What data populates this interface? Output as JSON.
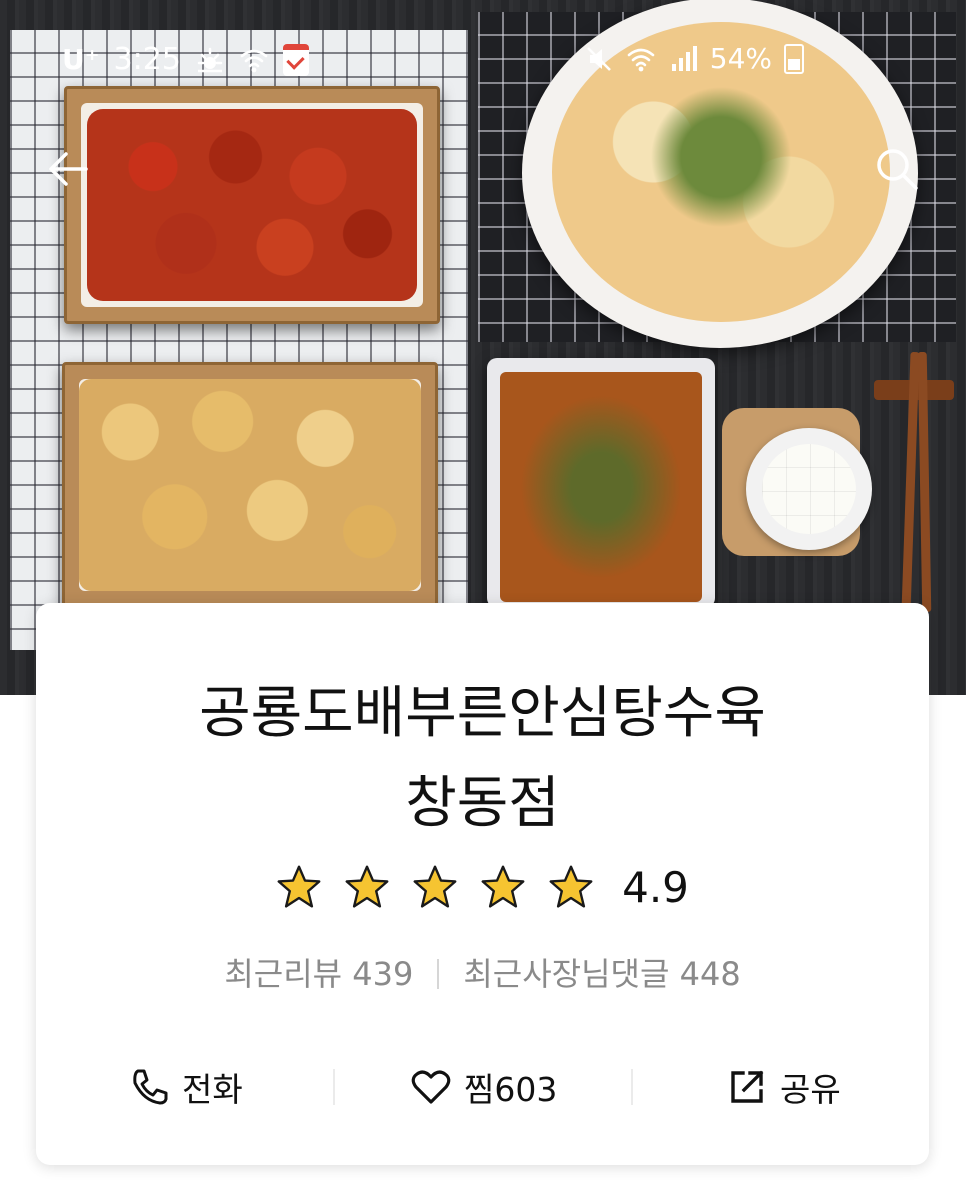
{
  "status_bar": {
    "carrier": "U⁺",
    "time": "3:25",
    "battery": "54%"
  },
  "nav": {
    "back_icon": "arrow-left-icon",
    "search_icon": "search-icon"
  },
  "store": {
    "name_line1": "공룡도배부른안심탕수육",
    "name_line2": "창동점",
    "rating_stars": 5,
    "rating_value": "4.9",
    "recent_reviews_label": "최근리뷰",
    "recent_reviews_count": "439",
    "owner_replies_label": "최근사장님댓글",
    "owner_replies_count": "448"
  },
  "actions": {
    "call_label": "전화",
    "like_label": "찜",
    "like_count": "603",
    "share_label": "공유"
  },
  "colors": {
    "star_fill": "#f6c431",
    "star_outline": "#1a1a1a",
    "text_primary": "#111111",
    "text_secondary": "#8a8a8a"
  }
}
